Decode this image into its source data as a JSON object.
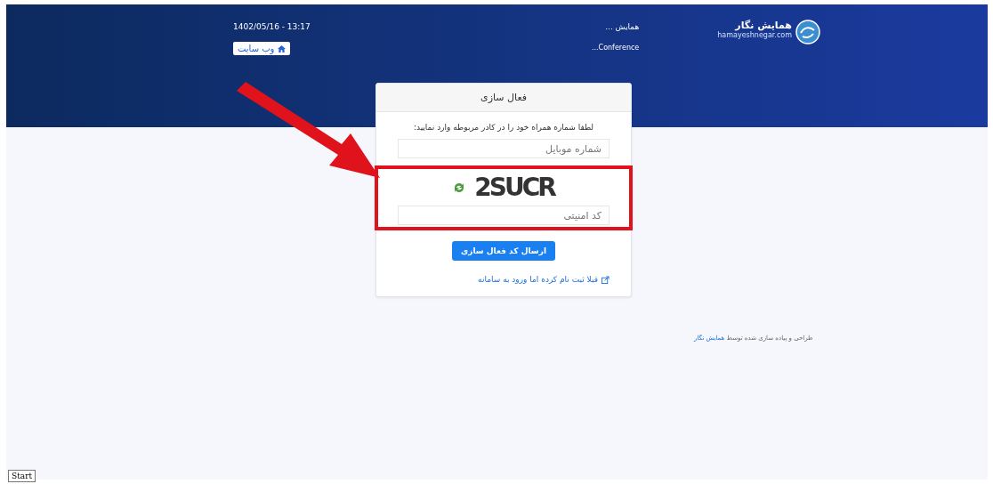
{
  "header": {
    "datetime": "1402/05/16 - 13:17",
    "website_button": "وب سایت",
    "event_title": "همایش ...",
    "event_subtitle": "...Conference",
    "logo_name": "همایش نگار",
    "logo_url": "hamayeshnegar.com"
  },
  "card": {
    "title": "فعال سازی",
    "instruction": "لطفا شماره همراه خود را در کادر مربوطه وارد نمایید:",
    "mobile_field": {
      "placeholder": "شماره موبایل"
    },
    "captcha_text": "2SUCR",
    "security_field": {
      "placeholder": "کد امنیتی"
    },
    "submit_button": "ارسال کد فعال سازی",
    "login_link": "قبلا ثبت نام کرده اما ورود به سامانه"
  },
  "footer": {
    "text": "طراحی و پیاده سازی شده توسط",
    "link": "همایش نگار"
  },
  "start_button": "Start"
}
